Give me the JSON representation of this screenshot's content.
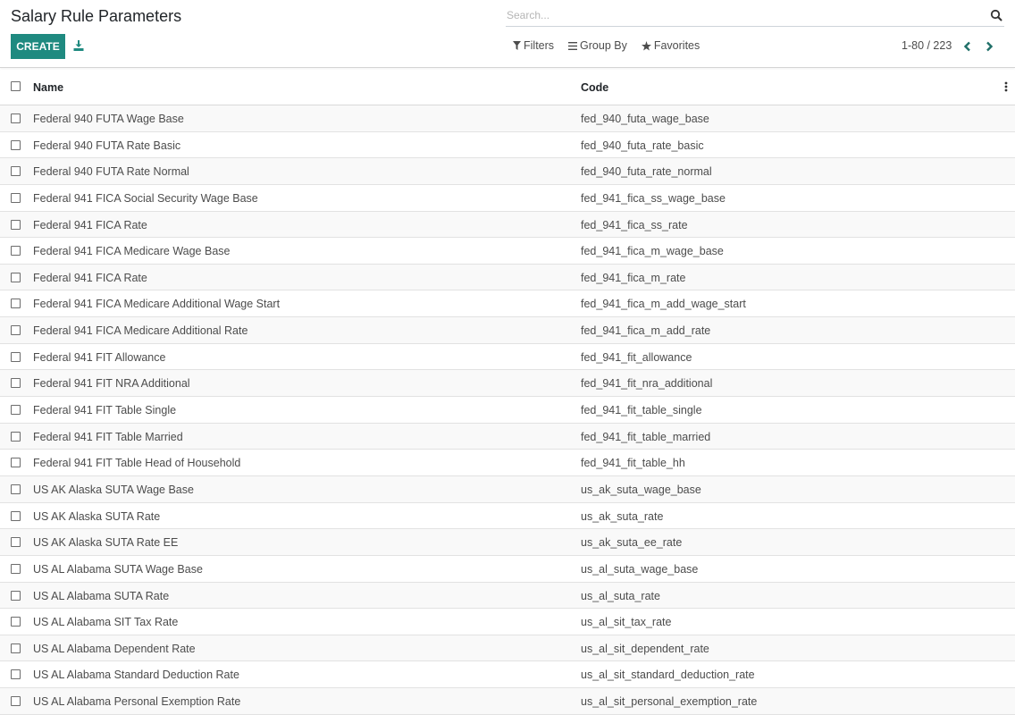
{
  "header": {
    "title": "Salary Rule Parameters",
    "create_label": "CREATE",
    "download_icon": "download-icon"
  },
  "search": {
    "placeholder": "Search...",
    "value": "",
    "icon": "search-icon"
  },
  "filters": {
    "filters_label": "Filters",
    "group_by_label": "Group By",
    "favorites_label": "Favorites"
  },
  "pager": {
    "range": "1-80 / 223"
  },
  "colors": {
    "accent": "#1f8a80",
    "stripe": "#f9f9f9",
    "text": "#4c4c4c"
  },
  "table": {
    "columns": [
      "Name",
      "Code"
    ],
    "rows": [
      {
        "name": "Federal 940 FUTA Wage Base",
        "code": "fed_940_futa_wage_base"
      },
      {
        "name": "Federal 940 FUTA Rate Basic",
        "code": "fed_940_futa_rate_basic"
      },
      {
        "name": "Federal 940 FUTA Rate Normal",
        "code": "fed_940_futa_rate_normal"
      },
      {
        "name": "Federal 941 FICA Social Security Wage Base",
        "code": "fed_941_fica_ss_wage_base"
      },
      {
        "name": "Federal 941 FICA Rate",
        "code": "fed_941_fica_ss_rate"
      },
      {
        "name": "Federal 941 FICA Medicare Wage Base",
        "code": "fed_941_fica_m_wage_base"
      },
      {
        "name": "Federal 941 FICA Rate",
        "code": "fed_941_fica_m_rate"
      },
      {
        "name": "Federal 941 FICA Medicare Additional Wage Start",
        "code": "fed_941_fica_m_add_wage_start"
      },
      {
        "name": "Federal 941 FICA Medicare Additional Rate",
        "code": "fed_941_fica_m_add_rate"
      },
      {
        "name": "Federal 941 FIT Allowance",
        "code": "fed_941_fit_allowance"
      },
      {
        "name": "Federal 941 FIT NRA Additional",
        "code": "fed_941_fit_nra_additional"
      },
      {
        "name": "Federal 941 FIT Table Single",
        "code": "fed_941_fit_table_single"
      },
      {
        "name": "Federal 941 FIT Table Married",
        "code": "fed_941_fit_table_married"
      },
      {
        "name": "Federal 941 FIT Table Head of Household",
        "code": "fed_941_fit_table_hh"
      },
      {
        "name": "US AK Alaska SUTA Wage Base",
        "code": "us_ak_suta_wage_base"
      },
      {
        "name": "US AK Alaska SUTA Rate",
        "code": "us_ak_suta_rate"
      },
      {
        "name": "US AK Alaska SUTA Rate EE",
        "code": "us_ak_suta_ee_rate"
      },
      {
        "name": "US AL Alabama SUTA Wage Base",
        "code": "us_al_suta_wage_base"
      },
      {
        "name": "US AL Alabama SUTA Rate",
        "code": "us_al_suta_rate"
      },
      {
        "name": "US AL Alabama SIT Tax Rate",
        "code": "us_al_sit_tax_rate"
      },
      {
        "name": "US AL Alabama Dependent Rate",
        "code": "us_al_sit_dependent_rate"
      },
      {
        "name": "US AL Alabama Standard Deduction Rate",
        "code": "us_al_sit_standard_deduction_rate"
      },
      {
        "name": "US AL Alabama Personal Exemption Rate",
        "code": "us_al_sit_personal_exemption_rate"
      }
    ]
  }
}
